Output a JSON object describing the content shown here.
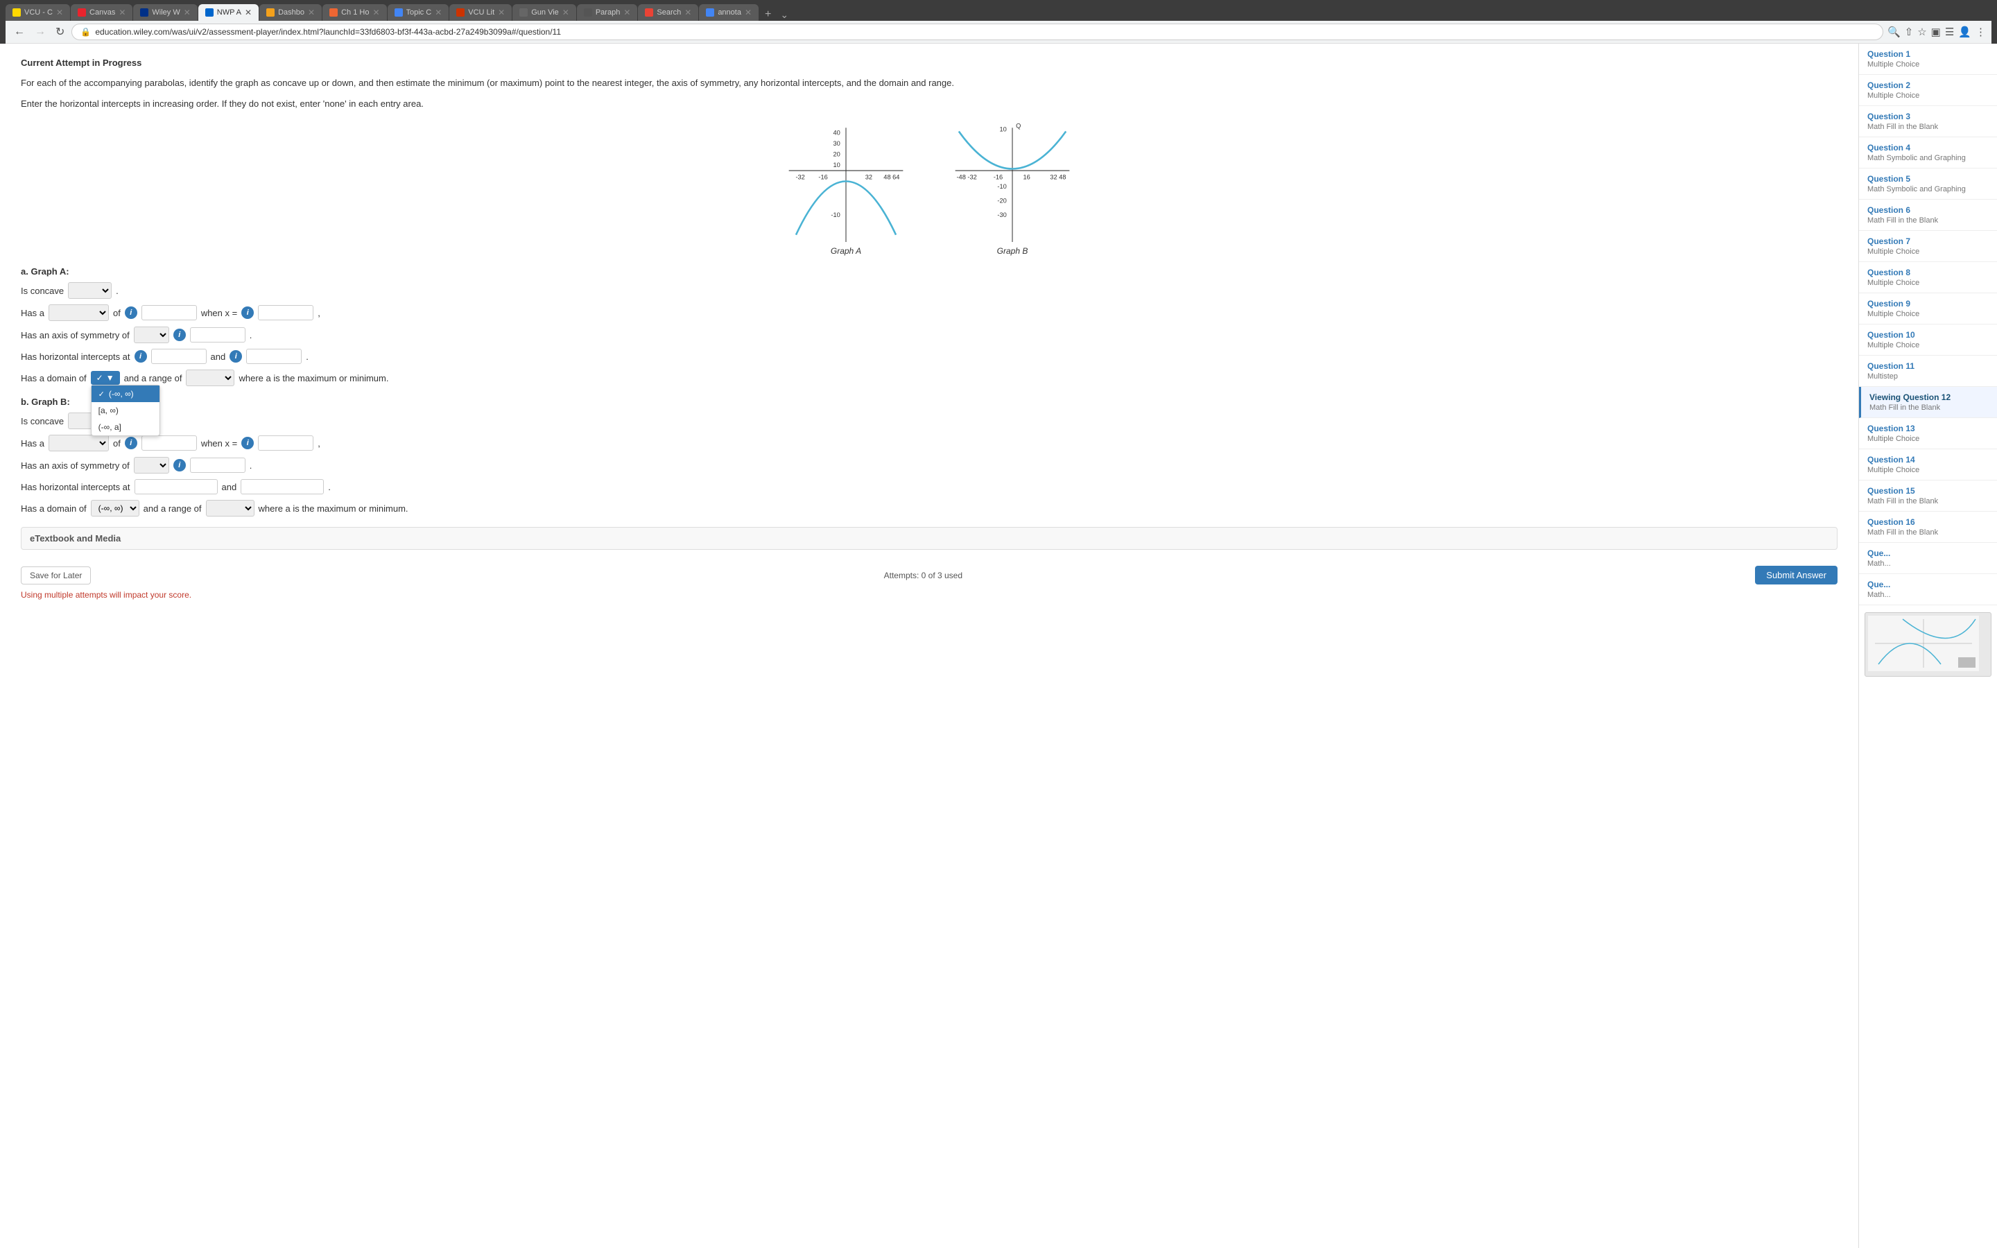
{
  "browser": {
    "tabs": [
      {
        "id": "vcu-c",
        "favicon_color": "#ffd700",
        "title": "VCU - C",
        "active": false
      },
      {
        "id": "canvas",
        "favicon_color": "#e8242d",
        "title": "Canvas",
        "active": false
      },
      {
        "id": "wiley-w",
        "favicon_color": "#003087",
        "title": "Wiley W",
        "active": false
      },
      {
        "id": "nwp-a",
        "favicon_color": "#0066cc",
        "title": "NWP A",
        "active": true
      },
      {
        "id": "dashb",
        "favicon_color": "#f4a11c",
        "title": "Dashbo",
        "active": false
      },
      {
        "id": "ch1-ho",
        "favicon_color": "#e63",
        "title": "Ch 1 Ho",
        "active": false
      },
      {
        "id": "topic-c",
        "favicon_color": "#4285f4",
        "title": "Topic C",
        "active": false
      },
      {
        "id": "vcu-lit",
        "favicon_color": "#cc3300",
        "title": "VCU Lit",
        "active": false
      },
      {
        "id": "gun-vie",
        "favicon_color": "#666",
        "title": "Gun Vie",
        "active": false
      },
      {
        "id": "paraph",
        "favicon_color": "#555",
        "title": "Paraph",
        "active": false
      },
      {
        "id": "search",
        "favicon_color": "#ea4335",
        "title": "Search",
        "active": false
      },
      {
        "id": "annota",
        "favicon_color": "#4285f4",
        "title": "annota",
        "active": false
      }
    ],
    "url": "education.wiley.com/was/ui/v2/assessment-player/index.html?launchId=33fd6803-bf3f-443a-acbd-27a249b3099a#/question/11"
  },
  "page": {
    "current_attempt_label": "Current Attempt in Progress",
    "question_text_1": "For each of the accompanying parabolas, identify the graph as concave up or down, and then estimate the minimum (or maximum) point to the nearest integer, the axis of symmetry, any horizontal intercepts, and the domain and range.",
    "question_text_2": "Enter the horizontal intercepts in increasing order. If they do not exist, enter 'none' in each entry area.",
    "graph_a_label": "Graph A",
    "graph_b_label": "Graph B",
    "section_a_label": "a. Graph A:",
    "is_concave_label": "Is concave",
    "has_a_label": "Has a",
    "of_label": "of",
    "when_x_label": "when x =",
    "has_axis_label": "Has an axis of symmetry of",
    "has_horizontal_label": "Has horizontal intercepts at",
    "and_label": "and",
    "has_domain_label": "Has a domain of",
    "range_label": "and a range of",
    "where_a_label": "where a is the maximum or minimum.",
    "section_b_label": "b. Graph B:",
    "etextbook_label": "eTextbook and Media",
    "save_later_label": "Save for Later",
    "attempts_label": "Attempts: 0 of 3 used",
    "submit_label": "Submit Answer",
    "impact_note": "Using multiple attempts will impact your score.",
    "dropdown_options": [
      "(-∞, ∞)",
      "[a, ∞)",
      "(-∞, a]"
    ],
    "selected_option": "(-∞, ∞)"
  },
  "sidebar": {
    "items": [
      {
        "id": 1,
        "title": "Question 1",
        "type": "Multiple Choice",
        "active": false
      },
      {
        "id": 2,
        "title": "Question 2",
        "type": "Multiple Choice",
        "active": false
      },
      {
        "id": 3,
        "title": "Question 3",
        "type": "Math Fill in the Blank",
        "active": false
      },
      {
        "id": 4,
        "title": "Question 4",
        "type": "Math Symbolic and Graphing",
        "active": false
      },
      {
        "id": 5,
        "title": "Question 5",
        "type": "Math Symbolic and Graphing",
        "active": false
      },
      {
        "id": 6,
        "title": "Question 6",
        "type": "Math Fill in the Blank",
        "active": false
      },
      {
        "id": 7,
        "title": "Question 7",
        "type": "Multiple Choice",
        "active": false
      },
      {
        "id": 8,
        "title": "Question 8",
        "type": "Multiple Choice",
        "active": false
      },
      {
        "id": 9,
        "title": "Question 9",
        "type": "Multiple Choice",
        "active": false
      },
      {
        "id": 10,
        "title": "Question 10",
        "type": "Multiple Choice",
        "active": false
      },
      {
        "id": 11,
        "title": "Question 11",
        "type": "Multistep",
        "active": false
      },
      {
        "id": 12,
        "title": "Viewing Question 12",
        "type": "Math Fill in the Blank",
        "active": true
      },
      {
        "id": 13,
        "title": "Question 13",
        "type": "Multiple Choice",
        "active": false
      },
      {
        "id": 14,
        "title": "Question 14",
        "type": "Multiple Choice",
        "active": false
      },
      {
        "id": 15,
        "title": "Question 15",
        "type": "Math Fill in the Blank",
        "active": false
      },
      {
        "id": 16,
        "title": "Question 16",
        "type": "Math Fill in the Blank",
        "active": false
      },
      {
        "id": 17,
        "title": "Que...",
        "type": "Math...",
        "active": false
      },
      {
        "id": 18,
        "title": "Que...",
        "type": "Math...",
        "active": false
      }
    ]
  },
  "colors": {
    "accent": "#337ab7",
    "active_sidebar": "#1a5276",
    "curve": "#4ab3d4",
    "danger": "#c0392b"
  }
}
